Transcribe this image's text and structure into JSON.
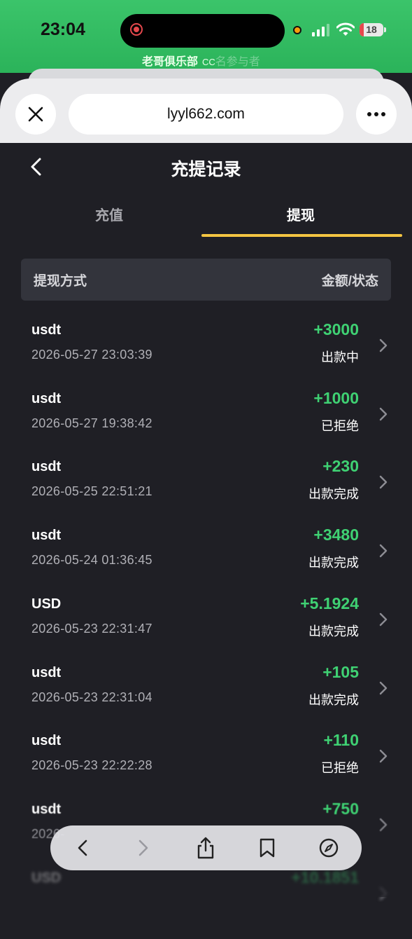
{
  "status_bar": {
    "time": "23:04",
    "battery": "18",
    "battery_level": 0.18,
    "carrier": "老哥俱乐部",
    "carrier_suffix": "CC",
    "carrier_faded": "名参与者"
  },
  "browser": {
    "url": "lyyl662.com"
  },
  "page": {
    "title": "充提记录",
    "tabs": [
      {
        "label": "充值",
        "active": false
      },
      {
        "label": "提现",
        "active": true
      }
    ],
    "accent_color": "#f4c542",
    "positive_color": "#3fd173",
    "table_header": {
      "left": "提现方式",
      "right": "金额/状态"
    },
    "records": [
      {
        "method": "usdt",
        "datetime": "2026-05-27 23:03:39",
        "amount": "+3000",
        "status": "出款中"
      },
      {
        "method": "usdt",
        "datetime": "2026-05-27 19:38:42",
        "amount": "+1000",
        "status": "已拒绝"
      },
      {
        "method": "usdt",
        "datetime": "2026-05-25 22:51:21",
        "amount": "+230",
        "status": "出款完成"
      },
      {
        "method": "usdt",
        "datetime": "2026-05-24 01:36:45",
        "amount": "+3480",
        "status": "出款完成"
      },
      {
        "method": "USD",
        "datetime": "2026-05-23 22:31:47",
        "amount": "+5.1924",
        "status": "出款完成"
      },
      {
        "method": "usdt",
        "datetime": "2026-05-23 22:31:04",
        "amount": "+105",
        "status": "出款完成"
      },
      {
        "method": "usdt",
        "datetime": "2026-05-23 22:22:28",
        "amount": "+110",
        "status": "已拒绝"
      },
      {
        "method": "usdt",
        "datetime": "2026-",
        "amount": "+750",
        "status": ""
      },
      {
        "method": "USD",
        "datetime": "",
        "amount": "+10.1851",
        "status": ""
      }
    ]
  },
  "toolbar": {
    "icons": [
      "chevron-left-icon",
      "chevron-right-icon",
      "share-icon",
      "bookmark-icon",
      "compass-icon"
    ]
  }
}
